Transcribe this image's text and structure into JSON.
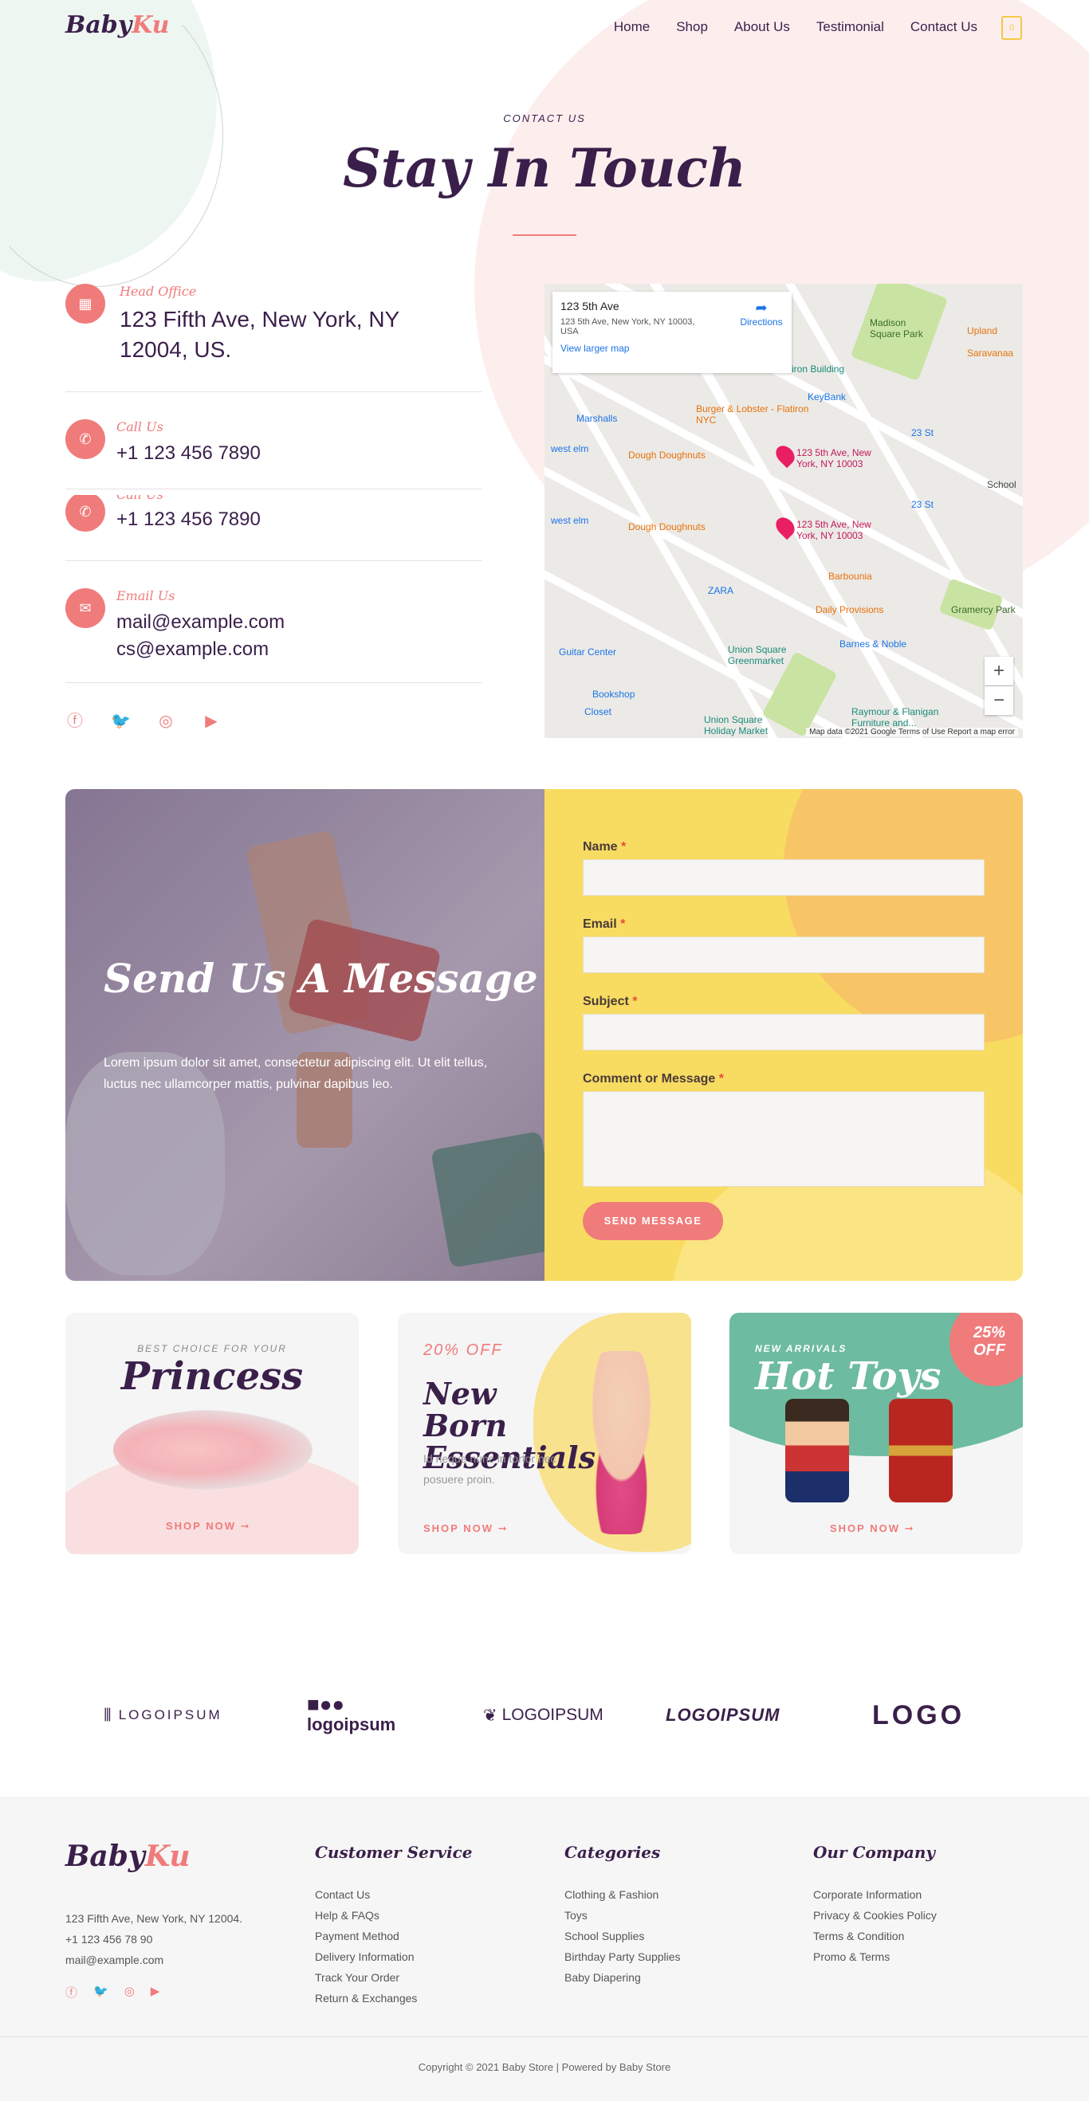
{
  "brand": {
    "name_a": "Baby",
    "name_b": "Ku"
  },
  "nav": {
    "items": [
      "Home",
      "Shop",
      "About Us",
      "Testimonial",
      "Contact Us"
    ],
    "cart_count": "0"
  },
  "contact": {
    "eyebrow": "CONTACT US",
    "title": "Stay In Touch",
    "rows": [
      {
        "label": "Head Office",
        "value": "123 Fifth Ave, New York, NY 12004, US.",
        "icon": "building-icon"
      },
      {
        "label": "Call Us",
        "value": "+1 123 456 7890",
        "icon": "phone-icon"
      },
      {
        "label": "Call Us",
        "value": "+1 123 456 7890",
        "icon": "phone-icon"
      },
      {
        "label": "Email Us",
        "value1": "mail@example.com",
        "value2": "cs@example.com",
        "icon": "mail-icon"
      }
    ],
    "socials": [
      "facebook-icon",
      "twitter-icon",
      "instagram-icon",
      "youtube-icon"
    ]
  },
  "map": {
    "place_title": "123 5th Ave",
    "place_address": "123 5th Ave, New York, NY 10003, USA",
    "larger_map": "View larger map",
    "directions": "Directions",
    "pin_label": "123 5th Ave, New York, NY 10003",
    "pois": [
      "Madison Square Park",
      "Flatiron Building",
      "KeyBank",
      "Marshalls",
      "Burger & Lobster - Flatiron NYC",
      "Dough Doughnuts",
      "Union Square Greenmarket",
      "Barnes & Noble",
      "Barbounia",
      "Daily Provisions",
      "Gramercy Park",
      "Guitar Center",
      "ZARA",
      "Raymour & Flanigan Furniture and...",
      "Union Square Holiday Market",
      "Upland",
      "Saravanaa",
      "School",
      "23 St",
      "Closet",
      "Bookshop",
      "west elm"
    ],
    "footer": "Map data ©2021 Google   Terms of Use   Report a map error"
  },
  "message": {
    "title": "Send Us A Message",
    "text": "Lorem ipsum dolor sit amet, consectetur adipiscing elit. Ut elit tellus, luctus nec ullamcorper mattis, pulvinar dapibus leo.",
    "fields": {
      "name": "Name",
      "email": "Email",
      "subject": "Subject",
      "comment": "Comment or Message",
      "required_mark": "*"
    },
    "button": "SEND MESSAGE"
  },
  "promos": [
    {
      "eyebrow": "BEST CHOICE FOR YOUR",
      "title": "Princess",
      "cta": "SHOP NOW ➞"
    },
    {
      "eyebrow": "20% OFF",
      "title": "New Born Essentials",
      "desc": "Id neque nunc in tortor nec posuere proin.",
      "cta": "SHOP NOW ➞"
    },
    {
      "eyebrow": "NEW ARRIVALS",
      "title": "Hot Toys",
      "badge": "25% OFF",
      "cta": "SHOP NOW ➞"
    }
  ],
  "brands": [
    "LOGOIPSUM",
    "logoipsum",
    "LOGOIPSUM",
    "LOGOIPSUM",
    "LOGO"
  ],
  "footer": {
    "address": "123 Fifth Ave, New York, NY 12004.",
    "phone": "+1 123 456 78 90",
    "email": "mail@example.com",
    "columns": [
      {
        "title": "Customer Service",
        "links": [
          "Contact Us",
          "Help & FAQs",
          "Payment Method",
          "Delivery Information",
          "Track Your Order",
          "Return & Exchanges"
        ]
      },
      {
        "title": "Categories",
        "links": [
          "Clothing & Fashion",
          "Toys",
          "School Supplies",
          "Birthday Party Supplies",
          "Baby Diapering"
        ]
      },
      {
        "title": "Our Company",
        "links": [
          "Corporate Information",
          "Privacy & Cookies Policy",
          "Terms & Condition",
          "Promo & Terms"
        ]
      }
    ],
    "copyright": "Copyright © 2021 Baby Store | Powered by Baby Store"
  },
  "colors": {
    "accent": "#f07b7b",
    "dark": "#3a1f4a",
    "yellow": "#f8dc61",
    "green": "#6dbba0"
  }
}
